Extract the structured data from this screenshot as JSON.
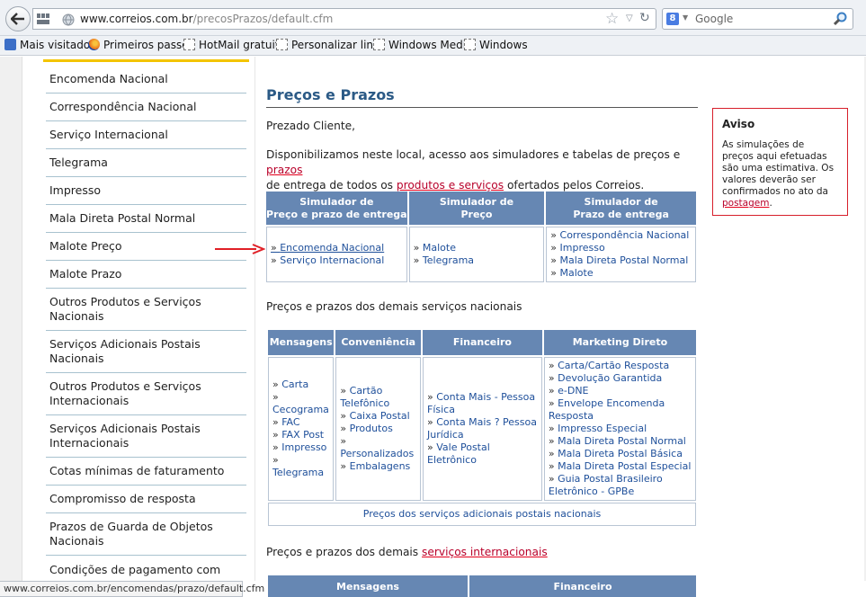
{
  "browser": {
    "url_host": "www.correios.com.br",
    "url_path": "/precosPrazos/default.cfm",
    "search_placeholder": "Google",
    "status_url": "www.correios.com.br/encomendas/prazo/default.cfm",
    "bookmarks": [
      "Mais visitados",
      "Primeiros passos",
      "HotMail gratuito",
      "Personalizar links",
      "Windows Media",
      "Windows"
    ]
  },
  "sidebar": {
    "items": [
      "Encomenda Nacional",
      "Correspondência Nacional",
      "Serviço Internacional",
      "Telegrama",
      "Impresso",
      "Mala Direta Postal Normal",
      "Malote Preço",
      "Malote Prazo",
      "Outros Produtos e Serviços Nacionais",
      "Serviços Adicionais Postais Nacionais",
      "Outros Produtos e Serviços Internacionais",
      "Serviços Adicionais Postais Internacionais",
      "Cotas mínimas de faturamento",
      "Compromisso de resposta",
      "Prazos de Guarda de Objetos Nacionais",
      "Condições de pagamento com"
    ]
  },
  "main": {
    "title": "Preços e Prazos",
    "greeting": "Prezado Cliente,",
    "intro_1": "Disponibilizamos neste local, acesso aos simuladores e tabelas de preços e ",
    "intro_link_prazos": "prazos",
    "intro_2": "de entrega de todos os ",
    "intro_link_produtos": "produtos e serviços",
    "intro_3": " ofertados pelos Correios.",
    "sim_table": {
      "headers": [
        [
          "Simulador de",
          "Preço e prazo de entrega"
        ],
        [
          "Simulador de",
          "Preço"
        ],
        [
          "Simulador de",
          "Prazo de entrega"
        ]
      ],
      "col1": [
        "Encomenda Nacional",
        "Serviço Internacional"
      ],
      "col2": [
        "Malote",
        "Telegrama"
      ],
      "col3": [
        "Correspondência Nacional",
        "Impresso",
        "Mala Direta Postal Normal",
        "Malote"
      ]
    },
    "nat_heading": "Preços e prazos dos demais serviços nacionais",
    "nat_table": {
      "headers": [
        "Mensagens",
        "Conveniência",
        "Financeiro",
        "Marketing Direto"
      ],
      "mensagens": [
        "Carta",
        "Cecograma",
        "FAC",
        "FAX Post",
        "Impresso",
        "Telegrama"
      ],
      "conveniencia": [
        "Cartão Telefônico",
        "Caixa Postal",
        "Produtos",
        "Personalizados",
        "Embalagens"
      ],
      "financeiro": [
        "Conta Mais - Pessoa Física",
        "Conta Mais ? Pessoa Jurídica",
        "Vale Postal Eletrônico"
      ],
      "marketing": [
        "Carta/Cartão Resposta",
        "Devolução Garantida",
        "e-DNE",
        "Envelope Encomenda Resposta",
        "Impresso Especial",
        "Mala Direta Postal Normal",
        "Mala Direta Postal Básica",
        "Mala Direta Postal Especial",
        "Guia Postal Brasileiro Eletrônico - GPBe"
      ],
      "footer_link": "Preços dos serviços adicionais postais nacionais"
    },
    "intl_heading": "Preços e prazos dos demais ",
    "intl_link": "serviços internacionais",
    "intl_table": {
      "headers": [
        "Mensagens",
        "Financeiro"
      ]
    }
  },
  "aviso": {
    "title": "Aviso",
    "body": "As simulações de preços aqui efetuadas são uma estimativa. Os valores deverão ser confirmados no ato da ",
    "link": "postagem",
    "tail": "."
  }
}
